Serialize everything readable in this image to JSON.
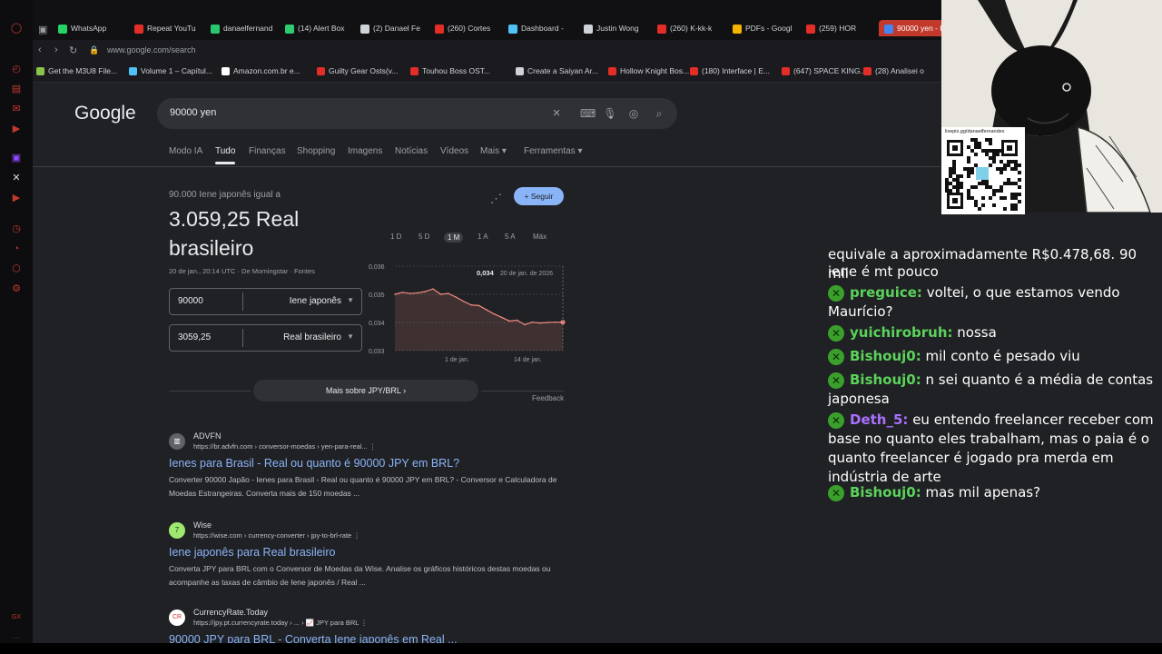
{
  "opera_sidebar": {
    "icons": [
      "opera-logo-icon",
      "history-icon",
      "bag-icon",
      "chat-icon",
      "video-icon",
      "twitch-icon",
      "x-icon",
      "youtube-icon",
      "clock-icon",
      "timer-icon",
      "extensions-icon",
      "settings-icon",
      "gx-icon",
      "more-icon"
    ],
    "accent": "#c0392b"
  },
  "tabs": [
    {
      "label": "WhatsApp",
      "color": "#25d366"
    },
    {
      "label": "Repeat YouTu",
      "color": "#e52d27"
    },
    {
      "label": "danaelfernand",
      "color": "#28c76f"
    },
    {
      "label": "(14) Alert Box",
      "color": "#2ecc71"
    },
    {
      "label": "(2) Danael Fe",
      "color": "#cfd2d6"
    },
    {
      "label": "(260) Cortes",
      "color": "#e52d27"
    },
    {
      "label": "Dashboard -",
      "color": "#4fc3f7"
    },
    {
      "label": "Justin Wong",
      "color": "#cfd2d6"
    },
    {
      "label": "(260) K-kk-k",
      "color": "#e52d27"
    },
    {
      "label": "PDFs - Googl",
      "color": "#f4b400"
    },
    {
      "label": "(259) HOR",
      "color": "#e52d27"
    },
    {
      "label": "90000 yen - P",
      "color": "#4285f4"
    }
  ],
  "address": {
    "url": "www.google.com/search"
  },
  "bookmarks": [
    {
      "label": "Get the M3U8 File...",
      "color": "#8bc34a"
    },
    {
      "label": "Volume 1 – Capítul...",
      "color": "#4fc3f7"
    },
    {
      "label": "Amazon.com.br e...",
      "color": "#ffffff"
    },
    {
      "label": "Guilty Gear Osts(v...",
      "color": "#e52d27"
    },
    {
      "label": "Touhou Boss OST...",
      "color": "#e52d27"
    },
    {
      "label": "Create a Saiyan Ar...",
      "color": "#cfd2d6"
    },
    {
      "label": "Hollow Knight Bos...",
      "color": "#e52d27"
    },
    {
      "label": "(180) Interface | E...",
      "color": "#e52d27"
    },
    {
      "label": "(647) SPACE KING...",
      "color": "#e52d27"
    },
    {
      "label": "(28) Analisei o",
      "color": "#e52d27"
    }
  ],
  "google": {
    "logo": "Google",
    "query": "90000 yen",
    "filters": [
      "Modo IA",
      "Tudo",
      "Finanças",
      "Shopping",
      "Imagens",
      "Notícias",
      "Vídeos",
      "Mais ▾",
      "Ferramentas ▾"
    ],
    "active_filter": "Tudo"
  },
  "converter": {
    "label": "90.000 Iene japonês igual a",
    "value": "3.059,25 Real brasileiro",
    "date": "20 de jan., 20:14 UTC · De Morningstar · Fontes",
    "from_amount": "90000",
    "from_currency": "Iene japonês",
    "to_amount": "3059,25",
    "to_currency": "Real brasileiro",
    "follow": "+ Seguir",
    "ranges": [
      "1 D",
      "5 D",
      "1 M",
      "1 A",
      "5 A",
      "Máx"
    ],
    "active_range": "1 M",
    "more": "Mais sobre JPY/BRL  ›",
    "feedback": "Feedback"
  },
  "chart_data": {
    "type": "area",
    "x_ticks": [
      "1 de jan.",
      "14 de jan."
    ],
    "y_ticks": [
      "0,036",
      "0,035",
      "0,034",
      "0,033"
    ],
    "ylim": [
      0.033,
      0.036
    ],
    "values": [
      0.035,
      0.03507,
      0.03503,
      0.03505,
      0.0351,
      0.03519,
      0.035,
      0.03503,
      0.0349,
      0.03475,
      0.03462,
      0.0346,
      0.03445,
      0.0343,
      0.03418,
      0.03405,
      0.03408,
      0.03392,
      0.03401,
      0.03398,
      0.034,
      0.03401,
      0.03401
    ],
    "tooltip_value": "0,034",
    "tooltip_date": "20 de jan. de 2026",
    "color": "#f28b82"
  },
  "results": [
    {
      "site": "ADVFN",
      "crumb": "https://br.advfn.com › conversor-moedas › yen-para-real...  ⋮",
      "title": "Ienes para Brasil - Real ou quanto é 90000 JPY em BRL?",
      "snippet": "Converter 90000 Japão - Ienes para Brasil - Real ou quanto é 90000 JPY em BRL? - Conversor e Calculadora de Moedas Estrangeiras. Converta mais de 150 moedas ...",
      "fav": "▥",
      "color": "#5f6368"
    },
    {
      "site": "Wise",
      "crumb": "https://wise.com › currency-converter › jpy-to-brl-rate  ⋮",
      "title": "Iene japonês para Real brasileiro",
      "snippet": "Converta JPY para BRL com o Conversor de Moedas da Wise. Analise os gráficos históricos destas moedas ou acompanhe as taxas de câmbio de Iene japonês / Real ...",
      "fav": "7",
      "color": "#9fe870"
    },
    {
      "site": "CurrencyRate.Today",
      "crumb": "https://jpy.pt.currencyrate.today › ... › 📈 JPY para BRL  ⋮",
      "title": "90000 JPY para BRL - Converta Iene japonês em Real ...",
      "snippet": "",
      "fav": "CR",
      "color": "#ffffff"
    }
  ],
  "overlay": {
    "qr_label": "livepix.gg/danaelfernandes"
  },
  "chat": {
    "partial_top": "equivale a aproximadamente R$0.478,68. 90 mil",
    "partial_second": "iene é mt pouco",
    "messages": [
      {
        "user": "preguice:",
        "text": "voltei, o que estamos vendo Maurício?",
        "color": "#5bd35b"
      },
      {
        "user": "yuichirobruh:",
        "text": "nossa",
        "color": "#5bd35b"
      },
      {
        "user": "Bishouj0:",
        "text": "mil conto é pesado viu",
        "color": "#5bd35b"
      },
      {
        "user": "Bishouj0:",
        "text": "n sei quanto é a média de contas japonesa",
        "color": "#5bd35b"
      },
      {
        "user": "Deth_5:",
        "text": "eu entendo freelancer receber com base no quanto eles trabalham, mas o paia é o quanto freelancer é jogado pra merda em indústria de arte",
        "color": "#a970ff"
      },
      {
        "user": "Bishouj0:",
        "text": "mas mil apenas?",
        "color": "#5bd35b"
      }
    ]
  }
}
